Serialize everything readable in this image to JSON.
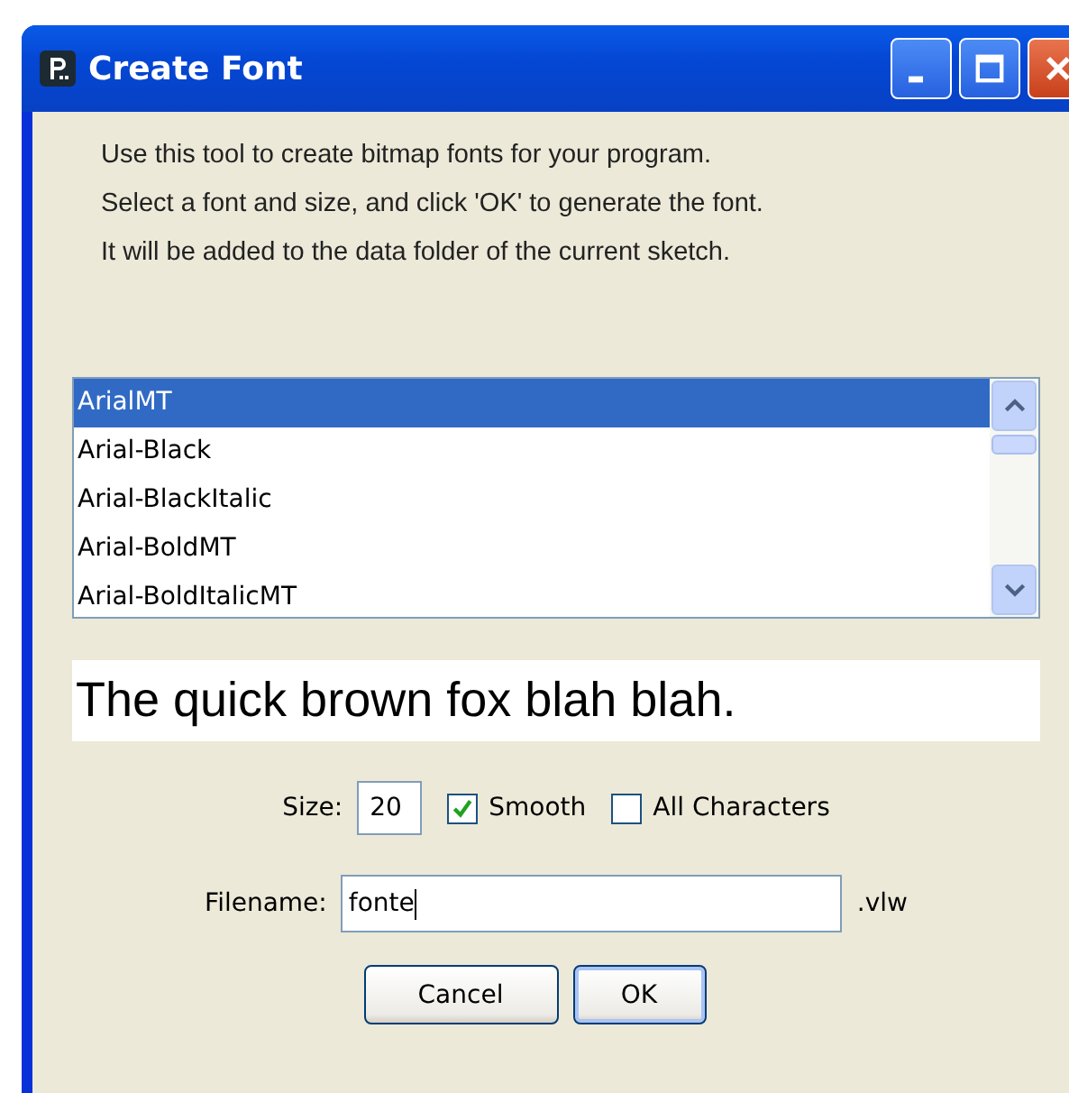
{
  "window": {
    "title": "Create Font"
  },
  "intro": [
    "Use this tool to create bitmap fonts for your program.",
    "Select a font and size, and click 'OK' to generate the font.",
    "It will be added to the data folder of the current sketch."
  ],
  "fonts": [
    {
      "name": "ArialMT",
      "selected": true
    },
    {
      "name": "Arial-Black",
      "selected": false
    },
    {
      "name": "Arial-BlackItalic",
      "selected": false
    },
    {
      "name": "Arial-BoldMT",
      "selected": false
    },
    {
      "name": "Arial-BoldItalicMT",
      "selected": false
    }
  ],
  "preview": "The quick brown fox blah blah.",
  "size": {
    "label": "Size:",
    "value": "20"
  },
  "options": [
    {
      "label": "Smooth",
      "checked": true
    },
    {
      "label": "All Characters",
      "checked": false
    }
  ],
  "filename": {
    "label": "Filename:",
    "value": "fonte",
    "suffix": ".vlw"
  },
  "buttons": [
    {
      "label": "Cancel",
      "default": false
    },
    {
      "label": "OK",
      "default": true
    }
  ]
}
